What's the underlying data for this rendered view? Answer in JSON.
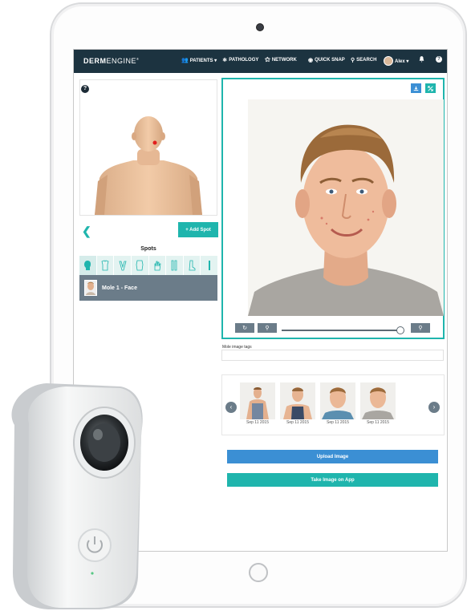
{
  "app": {
    "logo_bold": "DERM",
    "logo_light": "ENGINE",
    "logo_mark": "®"
  },
  "nav": {
    "patients": "PATIENTS ▾",
    "pathology": "PATHOLOGY",
    "network": "NETWORK",
    "quick_snap": "QUICK SNAP",
    "search": "SEARCH",
    "user": "Alex ▾"
  },
  "left": {
    "help": "?",
    "add_spot": "+ Add Spot",
    "spots_title": "Spots",
    "spot_item": "Mole 1 - Face"
  },
  "viewer": {
    "tags_label": "Mole image tags",
    "tags_value": "",
    "slider_value": 0.97
  },
  "thumbnails": [
    {
      "date": "Sep 11 2015"
    },
    {
      "date": "Sep 11 2015"
    },
    {
      "date": "Sep 11 2015"
    },
    {
      "date": "Sep 11 2015"
    }
  ],
  "actions": {
    "upload": "Upload Image",
    "take": "Take Image on App"
  },
  "colors": {
    "nav_bg": "#1c3340",
    "teal": "#1fb5ad",
    "blue": "#3b8fd4",
    "slate": "#6b7c89"
  }
}
